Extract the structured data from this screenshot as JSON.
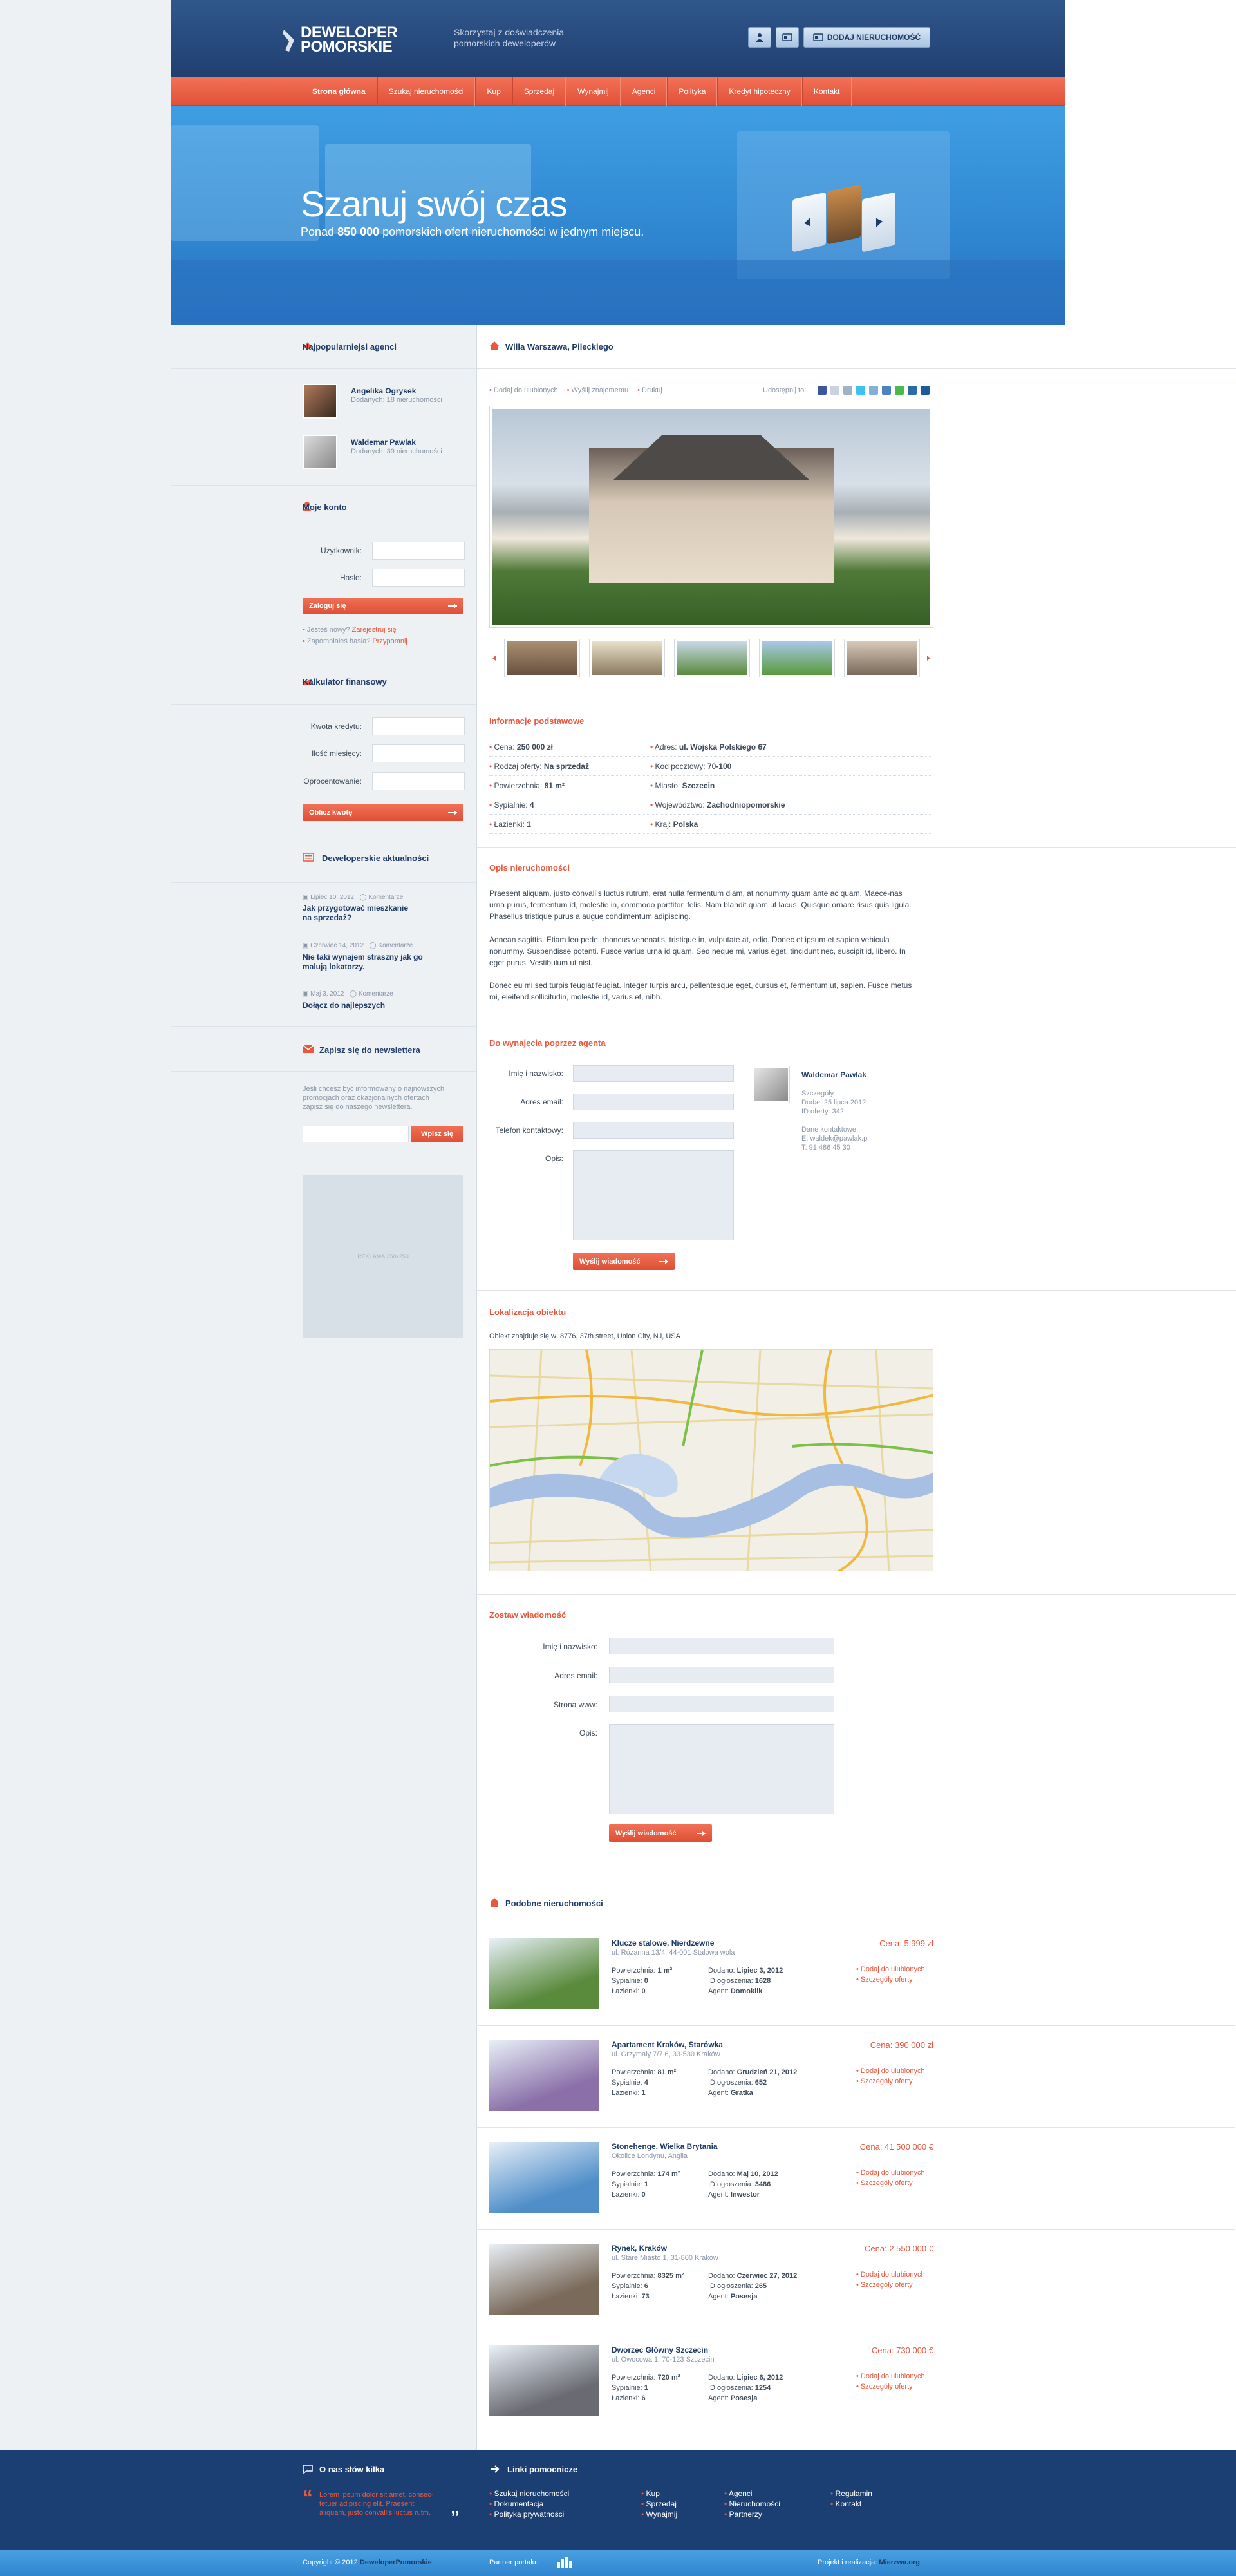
{
  "colors": {
    "navy": "#1d3b66",
    "orange": "#e9573c",
    "sidebar_bg": "#edf1f4"
  },
  "header": {
    "logo_line1": "DEWELOPER",
    "logo_line2": "POMORSKIE",
    "tagline_line1": "Skorzystaj z doświadczenia",
    "tagline_line2": "pomorskich deweloperów",
    "add_property_button": "DODAJ NIERUCHOMOŚĆ",
    "user_icon": "user-icon",
    "card_icon": "id-card-icon"
  },
  "nav": {
    "items": [
      "Strona główna",
      "Szukaj nieruchomości",
      "Kup",
      "Sprzedaj",
      "Wynajmij",
      "Agenci",
      "Polityka",
      "Kredyt hipoteczny",
      "Kontakt"
    ],
    "active": "Strona główna"
  },
  "hero": {
    "title": "Szanuj swój czas",
    "subtitle_pre": "Ponad ",
    "subtitle_bold": "850 000",
    "subtitle_post": " pomorskich ofert nieruchomości w jednym miejscu."
  },
  "sidebar": {
    "agents_title": "Najpopularniejsi agenci",
    "agents": [
      {
        "name": "Angelika Ogrysek",
        "meta": "Dodanych: 18 nieruchomości"
      },
      {
        "name": "Waldemar Pawlak",
        "meta": "Dodanych: 39 nieruchomości"
      }
    ],
    "account_title": "Moje konto",
    "login_label": "Użytkownik:",
    "password_label": "Hasło:",
    "login_button": "Zaloguj się",
    "register_pre": "Jesteś nowy? ",
    "register_link": "Zarejestruj się",
    "forgot_pre": "Zapomniałeś hasła? ",
    "forgot_link": "Przypomnij",
    "calc_title": "Kalkulator finansowy",
    "calc_amount": "Kwota kredytu:",
    "calc_months": "Ilość miesięcy:",
    "calc_rate": "Oprocentowanie:",
    "calc_button": "Oblicz kwotę",
    "news_title": "Deweloperskie aktualności",
    "news": [
      {
        "date": "Lipiec 10, 2012",
        "comments": "Komentarze",
        "title_line1": "Jak przygotować mieszkanie",
        "title_line2": "na sprzedaż?"
      },
      {
        "date": "Czerwiec 14, 2012",
        "comments": "Komentarze",
        "title_line1": "Nie taki wynajem straszny jak go",
        "title_line2": "malują lokatorzy."
      },
      {
        "date": "Maj 3, 2012",
        "comments": "Komentarze",
        "title_line1": "Dołącz do najlepszych",
        "title_line2": ""
      }
    ],
    "newsletter_title": "Zapisz się do newslettera",
    "newsletter_text_1": "Jeśli chcesz być informowany o najnowszych",
    "newsletter_text_2": "promocjach oraz okazjonalnych ofertach",
    "newsletter_text_3": "zapisz się do naszego newslettera.",
    "newsletter_button": "Wpisz się",
    "ad_text": "REKLAMA 250x250"
  },
  "property": {
    "title": "Willa Warszawa, Pileckiego",
    "actions": [
      "Dodaj do ulubionych",
      "Wyślij znajomemu",
      "Drukuj"
    ],
    "share_label": "Udostępnij to:",
    "info_title": "Informacje podstawowe",
    "info_left": [
      {
        "label": "Cena: ",
        "value": "250 000 zł"
      },
      {
        "label": "Rodzaj oferty: ",
        "value": "Na sprzedaż"
      },
      {
        "label": "Powierzchnia: ",
        "value": "81 m²"
      },
      {
        "label": "Sypialnie: ",
        "value": "4"
      },
      {
        "label": "Łazienki: ",
        "value": "1"
      }
    ],
    "info_right": [
      {
        "label": "Adres: ",
        "value": "ul. Wojska Polskiego 67"
      },
      {
        "label": "Kod pocztowy: ",
        "value": "70-100"
      },
      {
        "label": "Miasto: ",
        "value": "Szczecin"
      },
      {
        "label": "Województwo: ",
        "value": "Zachodniopomorskie"
      },
      {
        "label": "Kraj: ",
        "value": "Polska"
      }
    ],
    "desc_title": "Opis nieruchomości",
    "desc_p1": "Praesent aliquam, justo convallis luctus rutrum, erat nulla fermentum diam, at nonummy quam ante ac quam. Maece-nas urna purus, fermentum id, molestie in, commodo porttitor, felis. Nam blandit quam ut lacus. Quisque ornare risus quis ligula. Phasellus tristique purus a augue condimentum adipiscing.",
    "desc_p2": "Aenean sagittis. Etiam leo pede, rhoncus venenatis, tristique in, vulputate at, odio. Donec et ipsum et sapien vehicula nonummy. Suspendisse potenti. Fusce varius urna id quam. Sed neque mi, varius eget, tincidunt nec, suscipit id, libero. In eget purus. Vestibulum ut nisl.",
    "desc_p3": "Donec eu mi sed turpis feugiat feugiat. Integer turpis arcu, pellentesque eget, cursus et, fermentum ut, sapien. Fusce metus mi, eleifend sollicitudin, molestie id, varius et, nibh.",
    "rent_title": "Do wynajęcia poprzez agenta",
    "rent_fields": [
      "Imię i nazwisko:",
      "Adres email:",
      "Telefon kontaktowy:",
      "Opis:"
    ],
    "rent_button": "Wyślij wiadomość",
    "agent_name": "Waldemar Pawlak",
    "agent_details_title": "Szczegóły:",
    "agent_added": "Dodał: 25 lipca 2012",
    "agent_id": "ID oferty: 342",
    "agent_contact_title": "Dane kontaktowe:",
    "agent_email": "E: waldek@pawlak.pl",
    "agent_phone": "T: 91 486 45 30",
    "location_title": "Lokalizacja obiektu",
    "location_text": "Obiekt znajduje się w: 8776, 37th street, Union City, NJ, USA",
    "message_title": "Zostaw wiadomość",
    "message_fields": [
      "Imię i nazwisko:",
      "Adres email:",
      "Strona www:",
      "Opis:"
    ],
    "message_button": "Wyślij wiadomość",
    "similar_title": "Podobne nieruchomości",
    "similar": [
      {
        "title": "Klucze stalowe, Nierdzewne",
        "address": "ul. Różanna 13/4, 44-001 Stalowa wola",
        "area": "1 m²",
        "bedrooms": "0",
        "bathrooms": "0",
        "added": "Lipiec 3, 2012",
        "id": "1628",
        "agent": "Domoklik",
        "price": "5 999 zł",
        "color": "#5a8a3c"
      },
      {
        "title": "Apartament Kraków, Starówka",
        "address": "ul. Grzymały 7/7 6, 33-530 Kraków",
        "area": "81 m²",
        "bedrooms": "4",
        "bathrooms": "1",
        "added": "Grudzień 21, 2012",
        "id": "652",
        "agent": "Gratka",
        "price": "390 000 zł",
        "color": "#8a6fa8"
      },
      {
        "title": "Stonehenge, Wielka Brytania",
        "address": "Okolice Londynu, Anglia",
        "area": "174 m²",
        "bedrooms": "1",
        "bathrooms": "0",
        "added": "Maj 10, 2012",
        "id": "3486",
        "agent": "Inwestor",
        "price": "41 500 000 €",
        "color": "#4f8ec9"
      },
      {
        "title": "Rynek, Kraków",
        "address": "ul. Stare Miasto 1, 31-800 Kraków",
        "area": "8325 m²",
        "bedrooms": "6",
        "bathrooms": "73",
        "added": "Czerwiec 27, 2012",
        "id": "265",
        "agent": "Posesja",
        "price": "2 550 000 €",
        "color": "#7a6a5a"
      },
      {
        "title": "Dworzec Główny Szczecin",
        "address": "ul. Owocowa 1, 70-123 Szczecin",
        "area": "720 m²",
        "bedrooms": "1",
        "bathrooms": "6",
        "added": "Lipiec 6, 2012",
        "id": "1254",
        "agent": "Posesja",
        "price": "730 000 €",
        "color": "#6a6a72"
      }
    ],
    "similar_labels": {
      "area": "Powierzchnia: ",
      "bedrooms": "Sypialnie: ",
      "bathrooms": "Łazienki: ",
      "added": "Dodano: ",
      "id": "ID ogłoszenia: ",
      "agent": "Agent: ",
      "price": "Cena: ",
      "fav": "Dodaj do ulubionych",
      "details": "Szczegóły oferty"
    }
  },
  "footer": {
    "about_title": "O nas słów kilka",
    "about_text_1": "Lorem ipsum dolor sit amet, consec-",
    "about_text_2": "tetuer adipiscing elit. Praesent",
    "about_text_3": "aliquam, justo convallis luctus rutm.",
    "links_title": "Linki pomocnicze",
    "links": [
      [
        "Szukaj nieruchomości",
        "Dokumentacja",
        "Polityka prywatności"
      ],
      [
        "Kup",
        "Sprzedaj",
        "Wynajmij"
      ],
      [
        "Agenci",
        "Nieruchomości",
        "Partnerzy"
      ],
      [
        "Regulamin",
        "Kontakt"
      ]
    ],
    "copyright_pre": "Copyright © 2012 ",
    "copyright_brand": "DeweloperPomorskie",
    "partner_label": "Partner portalu:",
    "credits_pre": "Projekt i realizacja: ",
    "credits_brand": "Mierzwa.org"
  }
}
